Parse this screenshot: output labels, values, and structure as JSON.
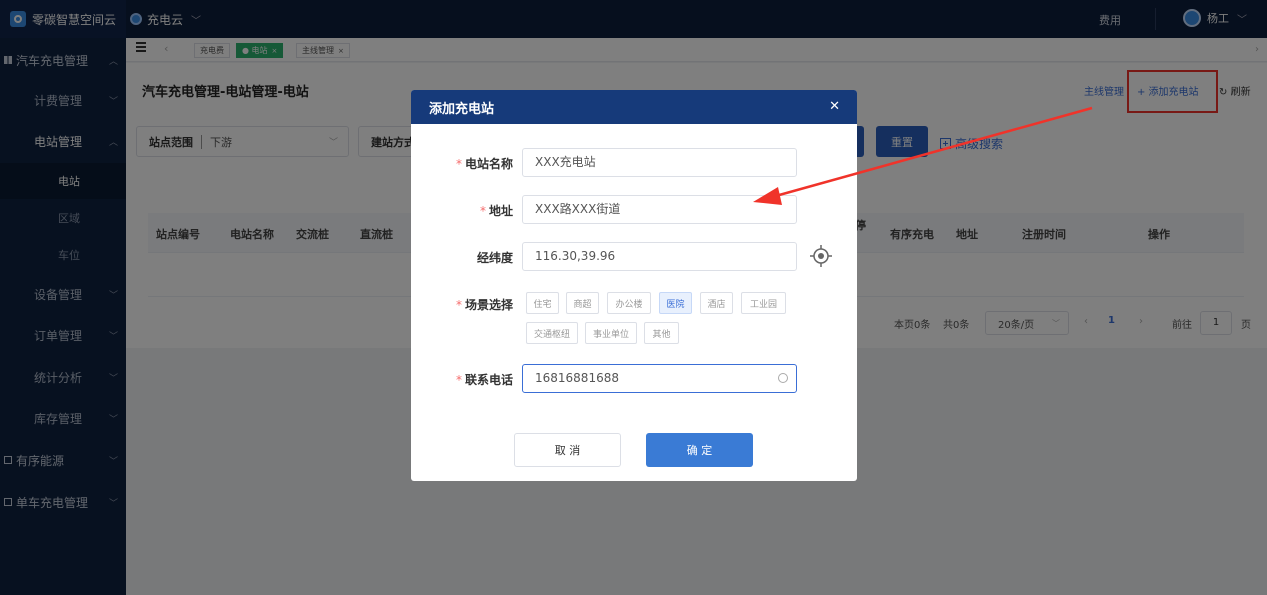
{
  "brand": {
    "name": "零碳智慧空间云"
  },
  "app": {
    "name": "充电云"
  },
  "topbar": {
    "cost": "费用",
    "user": "杨工"
  },
  "sidebar": {
    "groups": [
      {
        "label": "汽车充电管理"
      },
      {
        "label": "有序能源"
      },
      {
        "label": "单车充电管理"
      }
    ],
    "subs": [
      {
        "label": "计费管理"
      },
      {
        "label": "电站管理"
      },
      {
        "label": "设备管理"
      },
      {
        "label": "订单管理"
      },
      {
        "label": "统计分析"
      },
      {
        "label": "库存管理"
      }
    ],
    "leaves": [
      {
        "label": "电站"
      },
      {
        "label": "区域"
      },
      {
        "label": "车位"
      }
    ]
  },
  "tabs": [
    {
      "label": "充电费"
    },
    {
      "label": "● 电站"
    },
    {
      "label": "主线管理"
    }
  ],
  "page": {
    "title": "汽车充电管理-电站管理-电站",
    "actions": {
      "main_line": "主线管理",
      "add": "+ 添加充电站",
      "refresh": "刷新"
    },
    "filters": {
      "range_label": "站点范围",
      "range_value": "下游",
      "build_label": "建站方式"
    },
    "buttons": {
      "reset": "重置",
      "advanced": "高级搜索"
    },
    "columns": [
      "站点编号",
      "电站名称",
      "交流桩",
      "直流桩",
      "停",
      "有序充电",
      "地址",
      "注册时间",
      "操作"
    ],
    "pager": {
      "page_count": "本页0条",
      "total": "共0条",
      "size": "20条/页",
      "current": "1",
      "goto": "前往",
      "goto_value": "1",
      "page_unit": "页"
    }
  },
  "dialog": {
    "title": "添加充电站",
    "fields": {
      "name_label": "电站名称",
      "name_value": "XXX充电站",
      "address_label": "地址",
      "address_value": "XXX路XXX街道",
      "coords_label": "经纬度",
      "coords_value": "116.30,39.96",
      "scene_label": "场景选择",
      "phone_label": "联系电话",
      "phone_value": "16816881688"
    },
    "scenes": [
      "住宅",
      "商超",
      "办公楼",
      "医院",
      "酒店",
      "工业园",
      "交通枢纽",
      "事业单位",
      "其他"
    ],
    "selected_scene": "医院",
    "cancel": "取 消",
    "ok": "确 定"
  },
  "colors": {
    "header": "#0d1f3c",
    "sidebar": "#0f2240",
    "dialog_header": "#163a7a",
    "primary": "#3a7bd5",
    "annotation": "#f0332a",
    "tab_active": "#2db36f"
  }
}
